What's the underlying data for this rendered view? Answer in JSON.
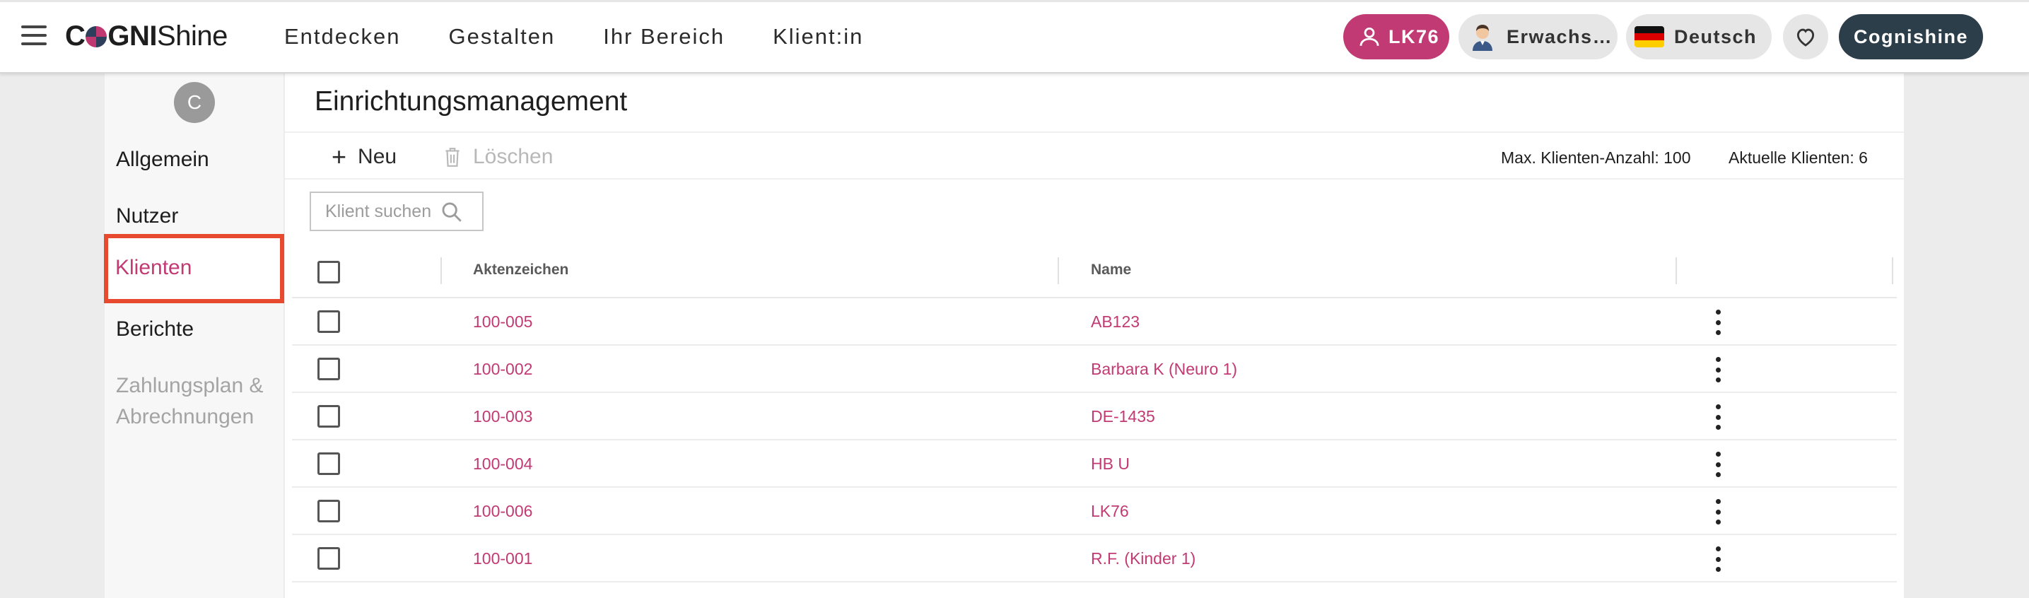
{
  "topbar": {
    "logo": {
      "part1": "C",
      "part2": "GNI",
      "part3": "Shine"
    },
    "nav": [
      "Entdecken",
      "Gestalten",
      "Ihr Bereich",
      "Klient:in"
    ],
    "user_label": "LK76",
    "age_label": "Erwachsene",
    "language_label": "Deutsch",
    "brand_label": "Cognishine"
  },
  "sidebar": {
    "avatar_initial": "C",
    "items": [
      {
        "label": "Allgemein",
        "state": "normal"
      },
      {
        "label": "Nutzer",
        "state": "normal"
      },
      {
        "label": "Klienten",
        "state": "active"
      },
      {
        "label": "Berichte",
        "state": "normal"
      },
      {
        "label": "Zahlungsplan &",
        "label2": "Abrechnungen",
        "state": "disabled"
      }
    ]
  },
  "main": {
    "title": "Einrichtungsmanagement",
    "toolbar": {
      "new_label": "Neu",
      "delete_label": "Löschen",
      "max_clients": "Max. Klienten-Anzahl: 100",
      "current_clients": "Aktuelle Klienten: 6"
    },
    "search": {
      "placeholder": "Klient suchen",
      "value": ""
    },
    "table": {
      "columns": [
        "Aktenzeichen",
        "Name"
      ],
      "rows": [
        {
          "id": "100-005",
          "name": "AB123"
        },
        {
          "id": "100-002",
          "name": "Barbara K (Neuro 1)"
        },
        {
          "id": "100-003",
          "name": "DE-1435"
        },
        {
          "id": "100-004",
          "name": "HB U"
        },
        {
          "id": "100-006",
          "name": "LK76"
        },
        {
          "id": "100-001",
          "name": "R.F. (Kinder 1)"
        }
      ]
    }
  },
  "colors": {
    "accent": "#c23a73",
    "brand_dark": "#2c3e4a",
    "highlight": "#e84a2f",
    "disabled": "#a4a4a4"
  },
  "icons": [
    "menu-icon",
    "user-icon",
    "person-avatar-icon",
    "german-flag-icon",
    "heart-icon",
    "plus-icon",
    "trash-icon",
    "search-icon",
    "more-vert-icon"
  ]
}
